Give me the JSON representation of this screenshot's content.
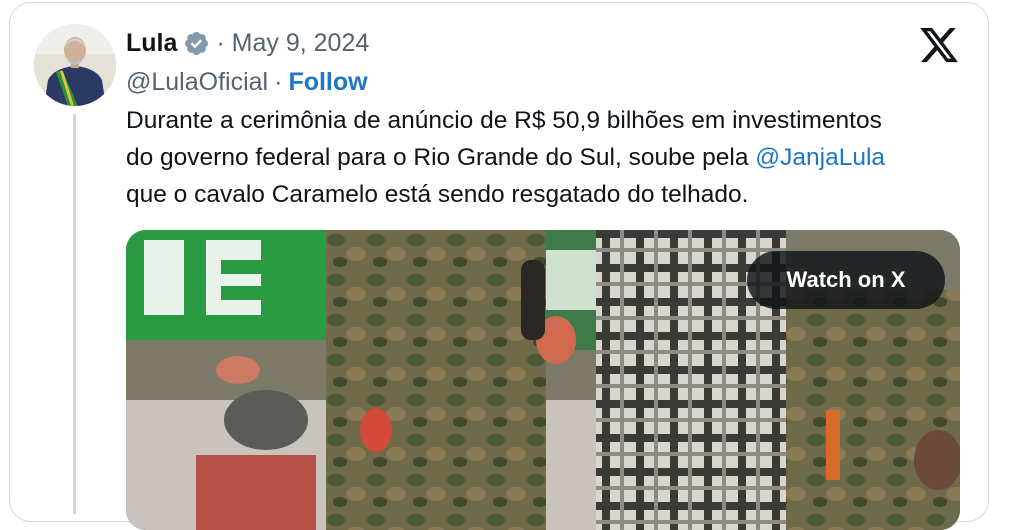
{
  "post": {
    "author_name": "Lula",
    "separator_date": "· May 9, 2024",
    "handle": "@LulaOficial",
    "dot": "·",
    "follow_label": "Follow",
    "text_line1": "Durante a cerimônia de anúncio de R$ 50,9 bilhões em investimentos",
    "text_line2_part1": "do governo federal para o Rio Grande do Sul, soube pela ",
    "mention": "@JanjaLula",
    "text_line3": "que o cavalo Caramelo está sendo resgatado do telhado."
  },
  "media": {
    "watch_label": "Watch on X"
  },
  "icons": {
    "verified": "verified-badge-icon",
    "platform": "x-logo-icon"
  },
  "colors": {
    "link": "#1d76c6",
    "text": "#0f1419",
    "meta": "#536471",
    "border": "#cfd9de"
  }
}
